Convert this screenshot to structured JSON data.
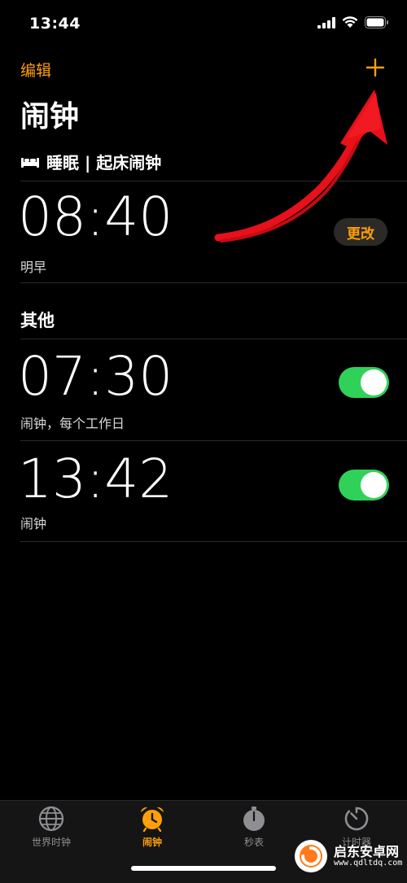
{
  "status_bar": {
    "time": "13:44"
  },
  "nav": {
    "edit_label": "编辑",
    "add_icon": "plus-icon",
    "title": "闹钟"
  },
  "sleep": {
    "icon": "bed-icon",
    "label": "睡眠 | 起床闹钟",
    "alarm_time": "08:40",
    "alarm_sub": "明早",
    "change_label": "更改"
  },
  "other": {
    "section_label": "其他",
    "alarms": [
      {
        "time": "07:30",
        "sub": "闹钟，每个工作日",
        "enabled": true
      },
      {
        "time": "13:42",
        "sub": "闹钟",
        "enabled": true
      }
    ]
  },
  "tab_bar": {
    "tabs": [
      {
        "label": "世界时钟",
        "icon": "globe-icon",
        "active": false
      },
      {
        "label": "闹钟",
        "icon": "alarm-clock-icon",
        "active": true
      },
      {
        "label": "秒表",
        "icon": "stopwatch-icon",
        "active": false
      },
      {
        "label": "计时器",
        "icon": "timer-icon",
        "active": false
      }
    ]
  },
  "watermark": {
    "title": "启东安卓网",
    "url": "www.qdltdq.com"
  },
  "colors": {
    "accent": "#ff9f0a",
    "toggle_on": "#30d158",
    "annotation_arrow": "#e8101a"
  }
}
